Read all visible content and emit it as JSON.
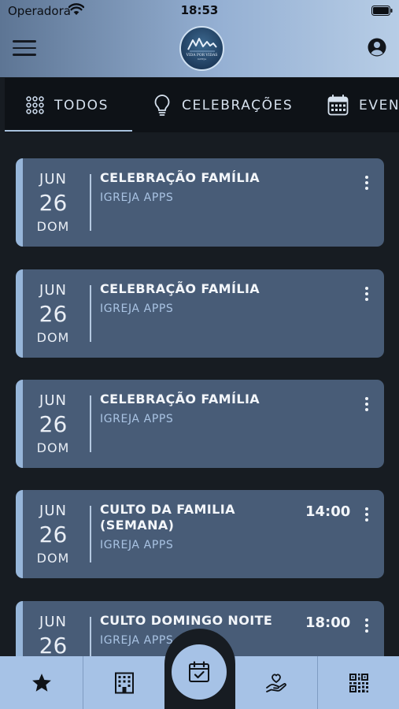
{
  "status_bar": {
    "carrier": "Operadora",
    "time": "18:53"
  },
  "header": {
    "logo_text": "VIDA POR VIDAS",
    "logo_subtext": "IGREJA"
  },
  "tabs": [
    {
      "label": "TODOS",
      "icon": "grid-dots-icon",
      "active": true
    },
    {
      "label": "CELEBRAÇÕES",
      "icon": "lightbulb-icon",
      "active": false
    },
    {
      "label": "EVENTOS",
      "icon": "calendar-icon",
      "active": false
    }
  ],
  "events": [
    {
      "month": "JUN",
      "day": "26",
      "weekday": "DOM",
      "title": "CELEBRAÇÃO FAMÍLIA",
      "organizer": "IGREJA APPS",
      "time": ""
    },
    {
      "month": "JUN",
      "day": "26",
      "weekday": "DOM",
      "title": "CELEBRAÇÃO FAMÍLIA",
      "organizer": "IGREJA APPS",
      "time": ""
    },
    {
      "month": "JUN",
      "day": "26",
      "weekday": "DOM",
      "title": "CELEBRAÇÃO FAMÍLIA",
      "organizer": "IGREJA APPS",
      "time": ""
    },
    {
      "month": "JUN",
      "day": "26",
      "weekday": "DOM",
      "title": "CULTO DA FAMILIA (SEMANA)",
      "organizer": "IGREJA APPS",
      "time": "14:00"
    },
    {
      "month": "JUN",
      "day": "26",
      "weekday": "",
      "title": "CULTO DOMINGO NOITE",
      "organizer": "IGREJA APPS",
      "time": "18:00"
    }
  ],
  "bottom_nav": [
    {
      "icon": "star-icon"
    },
    {
      "icon": "building-icon"
    },
    {
      "icon": "calendar-check-icon",
      "active": true
    },
    {
      "icon": "donate-hand-icon"
    },
    {
      "icon": "qr-code-icon"
    }
  ],
  "colors": {
    "background": "#171c22",
    "card": "#485c77",
    "card_accent": "#97b6da",
    "nav": "#a6c2e6",
    "organizer_text": "#a9c3e3"
  }
}
